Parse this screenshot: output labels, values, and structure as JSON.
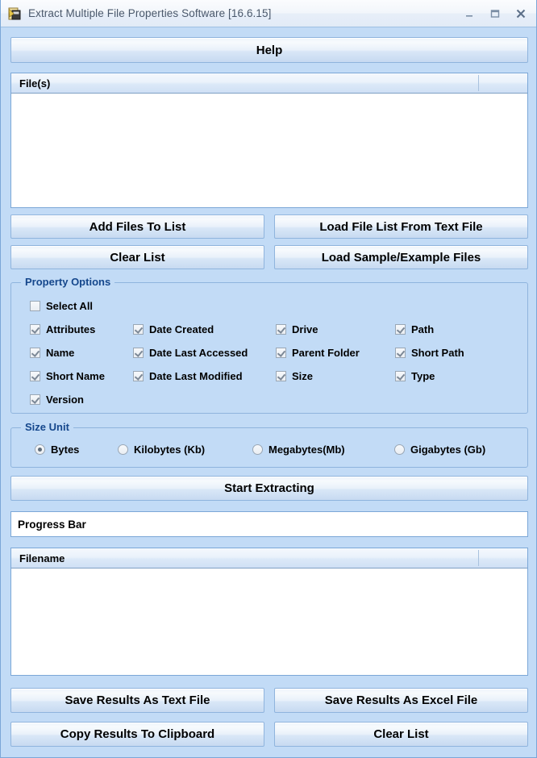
{
  "window": {
    "title": "Extract Multiple File Properties Software [16.6.15]",
    "icon": "app-icon",
    "minimize_label": "–",
    "maximize_label": "□",
    "close_label": "✕",
    "background_color": "#c2dbf6",
    "border_color": "#7ba7d7"
  },
  "help_button": {
    "label": "Help"
  },
  "file_list": {
    "column_header": "File(s)",
    "rows": []
  },
  "file_buttons": [
    {
      "label": "Add Files To List"
    },
    {
      "label": "Load File List From Text File"
    },
    {
      "label": "Clear List"
    },
    {
      "label": "Load Sample/Example Files"
    }
  ],
  "property_options": {
    "legend": "Property Options",
    "legend_color": "#15478c",
    "select_all": {
      "label": "Select All",
      "checked": false
    },
    "items": [
      {
        "label": "Attributes",
        "checked": true,
        "col": 0,
        "row": 0
      },
      {
        "label": "Date Created",
        "checked": true,
        "col": 1,
        "row": 0
      },
      {
        "label": "Drive",
        "checked": true,
        "col": 2,
        "row": 0
      },
      {
        "label": "Path",
        "checked": true,
        "col": 3,
        "row": 0
      },
      {
        "label": "Name",
        "checked": true,
        "col": 0,
        "row": 1
      },
      {
        "label": "Date Last Accessed",
        "checked": true,
        "col": 1,
        "row": 1
      },
      {
        "label": "Parent Folder",
        "checked": true,
        "col": 2,
        "row": 1
      },
      {
        "label": "Short Path",
        "checked": true,
        "col": 3,
        "row": 1
      },
      {
        "label": "Short Name",
        "checked": true,
        "col": 0,
        "row": 2
      },
      {
        "label": "Date Last Modified",
        "checked": true,
        "col": 1,
        "row": 2
      },
      {
        "label": "Size",
        "checked": true,
        "col": 2,
        "row": 2
      },
      {
        "label": "Type",
        "checked": true,
        "col": 3,
        "row": 2
      },
      {
        "label": "Version",
        "checked": true,
        "col": 0,
        "row": 3
      }
    ]
  },
  "size_unit": {
    "legend": "Size Unit",
    "options": [
      {
        "label": "Bytes",
        "selected": true
      },
      {
        "label": "Kilobytes (Kb)",
        "selected": false
      },
      {
        "label": "Megabytes(Mb)",
        "selected": false
      },
      {
        "label": "Gigabytes (Gb)",
        "selected": false
      }
    ]
  },
  "start_button": {
    "label": "Start Extracting"
  },
  "progress": {
    "text": "Progress Bar",
    "percent": 0
  },
  "results_list": {
    "column_header": "Filename",
    "rows": []
  },
  "result_buttons": [
    {
      "label": "Save Results As Text File"
    },
    {
      "label": "Save Results As Excel File"
    },
    {
      "label": "Copy Results To Clipboard"
    },
    {
      "label": "Clear List"
    }
  ]
}
